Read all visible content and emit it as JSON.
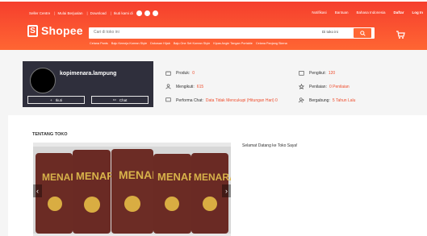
{
  "header": {
    "top_links": [
      "Seller Centre",
      "Mulai Berjualan",
      "Download",
      "Ikuti kami di"
    ],
    "right_links": [
      "Notifikasi",
      "Bantuan",
      "Bahasa Indonesia"
    ],
    "register": "Daftar",
    "login": "Log In",
    "brand": "Shopee",
    "search": {
      "placeholder": "Cari di toko ini",
      "scope": "Di toko ini"
    },
    "suggestions": [
      "Celana Pants",
      "Baju Kemeja Korean Style",
      "Dokosan Hijab",
      "Baju One Set Korean Style",
      "Kipas Angin Tangan Portable",
      "Celana Panjang Skena"
    ]
  },
  "shop": {
    "name": "kopimenara.lampung",
    "follow": "Ikuti",
    "chat": "Chat",
    "stats": [
      {
        "label": "Produk:",
        "value": "0"
      },
      {
        "label": "Mengikuti:",
        "value": "615"
      },
      {
        "label": "Performa Chat:",
        "value": "Data Tidak Mencukupi (Hitungan Hari) 0"
      },
      {
        "label": "Pengikut:",
        "value": "120"
      },
      {
        "label": "Penilaian:",
        "value": "0 Penilaian"
      },
      {
        "label": "Bergabung:",
        "value": "5 Tahun Lalu"
      }
    ]
  },
  "about": {
    "title": "TENTANG TOKO",
    "welcome": "Selamat Datang ke Toko Saya!"
  },
  "photo": {
    "brand": "MENARA"
  },
  "colors": {
    "accent": "#ee4d2d",
    "header": "#f63",
    "card": "#2f2f3c"
  }
}
